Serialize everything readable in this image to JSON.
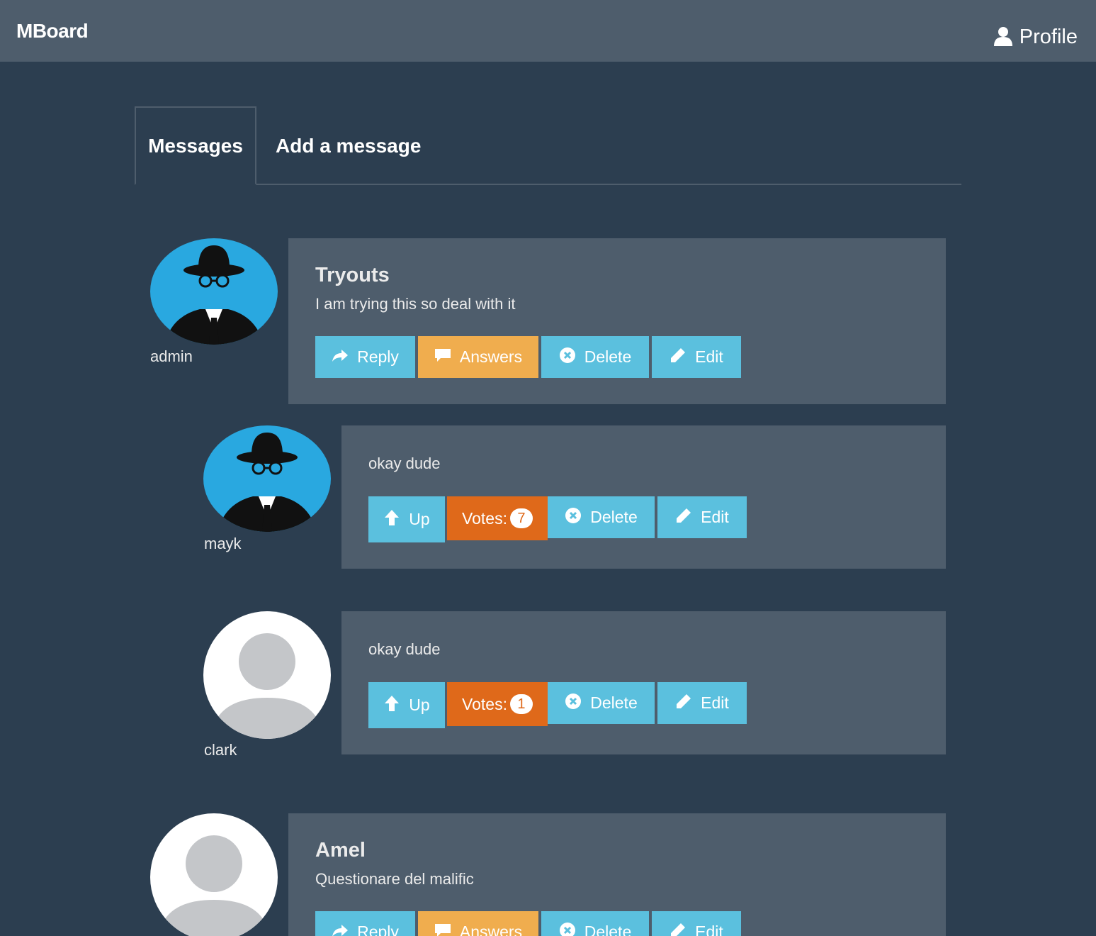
{
  "navbar": {
    "brand": "MBoard",
    "profile_label": "Profile"
  },
  "tabs": [
    {
      "label": "Messages",
      "active": true
    },
    {
      "label": "Add a message",
      "active": false
    }
  ],
  "messages": [
    {
      "author": "admin",
      "avatar": "hat-man-avatar",
      "title": "Tryouts",
      "body": "I am trying this so deal with it",
      "buttons": {
        "reply": "Reply",
        "answers": "Answers",
        "delete": "Delete",
        "edit": "Edit"
      },
      "answers": [
        {
          "author": "mayk",
          "avatar": "hat-man-avatar",
          "body": "okay dude",
          "buttons": {
            "up": "Up",
            "votes": "Votes:",
            "delete": "Delete",
            "edit": "Edit"
          },
          "votes": "7"
        },
        {
          "author": "clark",
          "avatar": "default-user-avatar",
          "body": "okay dude",
          "buttons": {
            "up": "Up",
            "votes": "Votes:",
            "delete": "Delete",
            "edit": "Edit"
          },
          "votes": "1"
        }
      ]
    },
    {
      "author": "",
      "avatar": "default-user-avatar",
      "title": "Amel",
      "body": "Questionare del malific",
      "buttons": {
        "reply": "Reply",
        "answers": "Answers",
        "delete": "Delete",
        "edit": "Edit"
      }
    }
  ],
  "colors": {
    "background": "#2c3e50",
    "panel": "#4e5d6c",
    "info": "#5bc0de",
    "warning": "#f0ad4e",
    "accent": "#df691a"
  }
}
